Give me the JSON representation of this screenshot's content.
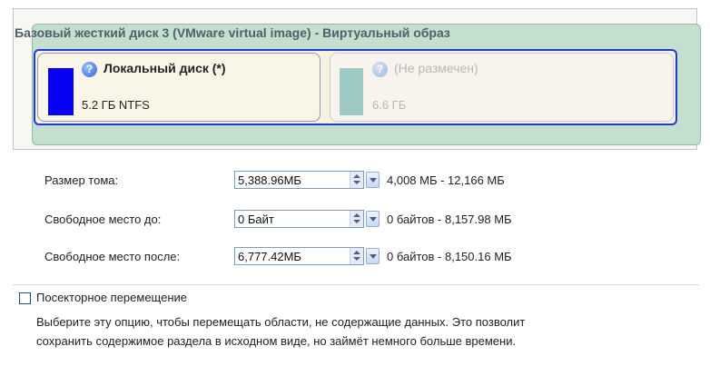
{
  "disk": {
    "title": "Базовый жесткий диск 3 (VMware virtual image) - Виртуальный образ",
    "partitions": [
      {
        "name": "Локальный диск (*)",
        "info": "5.2 ГБ NTFS",
        "color": "#0800f2"
      },
      {
        "name": "(Не размечен)",
        "info": "6.6 ГБ",
        "color": "#9fc9c5"
      }
    ]
  },
  "form": {
    "rows": [
      {
        "label": "Размер тома:",
        "value": "5,388.96МБ",
        "range": "4,008 МБ - 12,166 МБ"
      },
      {
        "label": "Свободное место до:",
        "value": "0 Байт",
        "range": "0 байтов - 8,157.98 МБ"
      },
      {
        "label": "Свободное место после:",
        "value": "6,777.42МБ",
        "range": "0 байтов - 8,150.16 МБ"
      }
    ]
  },
  "sector_move": {
    "label": "Посекторное перемещение",
    "checked": false,
    "description_line1": "Выберите эту опцию, чтобы перемещать области, не содержащие данных. Это позволит",
    "description_line2": "сохранить содержимое раздела в исходном виде, но займёт немного больше времени."
  },
  "icons": {
    "help": "help-icon",
    "spin": "spinner-icon",
    "dropdown": "chevron-down-icon"
  }
}
